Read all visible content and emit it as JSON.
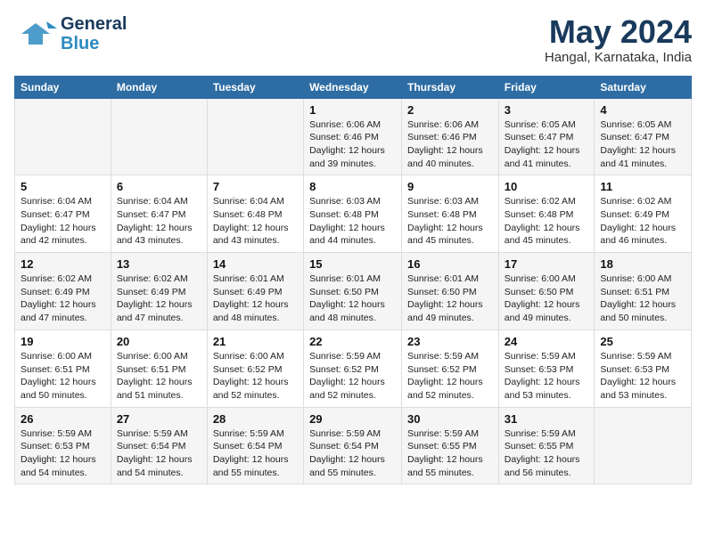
{
  "logo": {
    "line1": "General",
    "line2": "Blue"
  },
  "title": {
    "month_year": "May 2024",
    "location": "Hangal, Karnataka, India"
  },
  "weekdays": [
    "Sunday",
    "Monday",
    "Tuesday",
    "Wednesday",
    "Thursday",
    "Friday",
    "Saturday"
  ],
  "weeks": [
    [
      {
        "day": "",
        "info": ""
      },
      {
        "day": "",
        "info": ""
      },
      {
        "day": "",
        "info": ""
      },
      {
        "day": "1",
        "info": "Sunrise: 6:06 AM\nSunset: 6:46 PM\nDaylight: 12 hours\nand 39 minutes."
      },
      {
        "day": "2",
        "info": "Sunrise: 6:06 AM\nSunset: 6:46 PM\nDaylight: 12 hours\nand 40 minutes."
      },
      {
        "day": "3",
        "info": "Sunrise: 6:05 AM\nSunset: 6:47 PM\nDaylight: 12 hours\nand 41 minutes."
      },
      {
        "day": "4",
        "info": "Sunrise: 6:05 AM\nSunset: 6:47 PM\nDaylight: 12 hours\nand 41 minutes."
      }
    ],
    [
      {
        "day": "5",
        "info": "Sunrise: 6:04 AM\nSunset: 6:47 PM\nDaylight: 12 hours\nand 42 minutes."
      },
      {
        "day": "6",
        "info": "Sunrise: 6:04 AM\nSunset: 6:47 PM\nDaylight: 12 hours\nand 43 minutes."
      },
      {
        "day": "7",
        "info": "Sunrise: 6:04 AM\nSunset: 6:48 PM\nDaylight: 12 hours\nand 43 minutes."
      },
      {
        "day": "8",
        "info": "Sunrise: 6:03 AM\nSunset: 6:48 PM\nDaylight: 12 hours\nand 44 minutes."
      },
      {
        "day": "9",
        "info": "Sunrise: 6:03 AM\nSunset: 6:48 PM\nDaylight: 12 hours\nand 45 minutes."
      },
      {
        "day": "10",
        "info": "Sunrise: 6:02 AM\nSunset: 6:48 PM\nDaylight: 12 hours\nand 45 minutes."
      },
      {
        "day": "11",
        "info": "Sunrise: 6:02 AM\nSunset: 6:49 PM\nDaylight: 12 hours\nand 46 minutes."
      }
    ],
    [
      {
        "day": "12",
        "info": "Sunrise: 6:02 AM\nSunset: 6:49 PM\nDaylight: 12 hours\nand 47 minutes."
      },
      {
        "day": "13",
        "info": "Sunrise: 6:02 AM\nSunset: 6:49 PM\nDaylight: 12 hours\nand 47 minutes."
      },
      {
        "day": "14",
        "info": "Sunrise: 6:01 AM\nSunset: 6:49 PM\nDaylight: 12 hours\nand 48 minutes."
      },
      {
        "day": "15",
        "info": "Sunrise: 6:01 AM\nSunset: 6:50 PM\nDaylight: 12 hours\nand 48 minutes."
      },
      {
        "day": "16",
        "info": "Sunrise: 6:01 AM\nSunset: 6:50 PM\nDaylight: 12 hours\nand 49 minutes."
      },
      {
        "day": "17",
        "info": "Sunrise: 6:00 AM\nSunset: 6:50 PM\nDaylight: 12 hours\nand 49 minutes."
      },
      {
        "day": "18",
        "info": "Sunrise: 6:00 AM\nSunset: 6:51 PM\nDaylight: 12 hours\nand 50 minutes."
      }
    ],
    [
      {
        "day": "19",
        "info": "Sunrise: 6:00 AM\nSunset: 6:51 PM\nDaylight: 12 hours\nand 50 minutes."
      },
      {
        "day": "20",
        "info": "Sunrise: 6:00 AM\nSunset: 6:51 PM\nDaylight: 12 hours\nand 51 minutes."
      },
      {
        "day": "21",
        "info": "Sunrise: 6:00 AM\nSunset: 6:52 PM\nDaylight: 12 hours\nand 52 minutes."
      },
      {
        "day": "22",
        "info": "Sunrise: 5:59 AM\nSunset: 6:52 PM\nDaylight: 12 hours\nand 52 minutes."
      },
      {
        "day": "23",
        "info": "Sunrise: 5:59 AM\nSunset: 6:52 PM\nDaylight: 12 hours\nand 52 minutes."
      },
      {
        "day": "24",
        "info": "Sunrise: 5:59 AM\nSunset: 6:53 PM\nDaylight: 12 hours\nand 53 minutes."
      },
      {
        "day": "25",
        "info": "Sunrise: 5:59 AM\nSunset: 6:53 PM\nDaylight: 12 hours\nand 53 minutes."
      }
    ],
    [
      {
        "day": "26",
        "info": "Sunrise: 5:59 AM\nSunset: 6:53 PM\nDaylight: 12 hours\nand 54 minutes."
      },
      {
        "day": "27",
        "info": "Sunrise: 5:59 AM\nSunset: 6:54 PM\nDaylight: 12 hours\nand 54 minutes."
      },
      {
        "day": "28",
        "info": "Sunrise: 5:59 AM\nSunset: 6:54 PM\nDaylight: 12 hours\nand 55 minutes."
      },
      {
        "day": "29",
        "info": "Sunrise: 5:59 AM\nSunset: 6:54 PM\nDaylight: 12 hours\nand 55 minutes."
      },
      {
        "day": "30",
        "info": "Sunrise: 5:59 AM\nSunset: 6:55 PM\nDaylight: 12 hours\nand 55 minutes."
      },
      {
        "day": "31",
        "info": "Sunrise: 5:59 AM\nSunset: 6:55 PM\nDaylight: 12 hours\nand 56 minutes."
      },
      {
        "day": "",
        "info": ""
      }
    ]
  ]
}
